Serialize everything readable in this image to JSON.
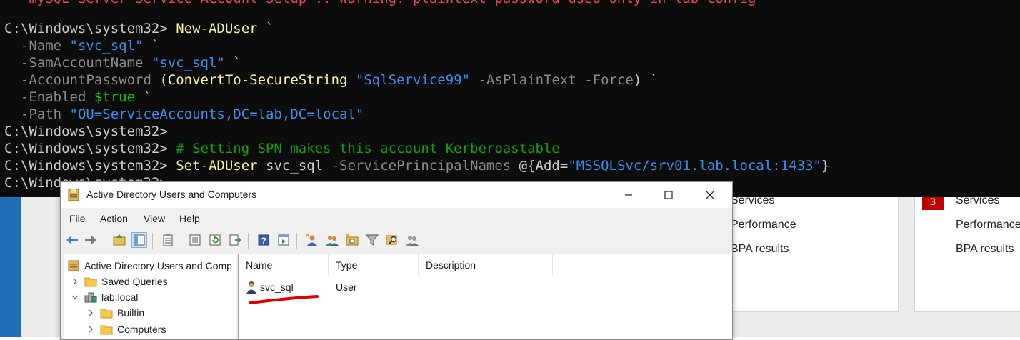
{
  "console": {
    "top_partial": "  -mySQL Server Service Account Setup :: Warning: plaintext password used only in lab config",
    "lines": [
      {
        "prompt": "C:\\Windows\\system32> ",
        "cmd": "New-ADUser",
        "rest": " `"
      },
      {
        "param": "  -Name ",
        "str": "\"svc_sql\"",
        "rest": " `"
      },
      {
        "param": "  -SamAccountName ",
        "str": "\"svc_sql\"",
        "rest": " `"
      },
      {
        "param": "  -AccountPassword ",
        "paren_open": "(",
        "cmd": "ConvertTo-SecureString",
        "space": " ",
        "str": "\"SqlService99\"",
        "param2": " -AsPlainText -Force",
        "paren_close": ")",
        "rest": " `"
      },
      {
        "param": "  -Enabled ",
        "var": "$true",
        "rest": " `"
      },
      {
        "param": "  -Path ",
        "str": "\"OU=ServiceAccounts,DC=lab,DC=local\""
      },
      {
        "prompt": "C:\\Windows\\system32>"
      },
      {
        "prompt": "C:\\Windows\\system32> ",
        "comment": "# Setting SPN makes this account Kerberoastable"
      },
      {
        "prompt": "C:\\Windows\\system32> ",
        "cmd": "Set-ADUser",
        "arg": " svc_sql",
        "param": " -ServicePrincipalNames",
        "brace_open": " @{Add=",
        "str": "\"MSSQLSvc/srv01.lab.local:1433\"",
        "brace_close": "}"
      },
      {
        "prompt": "C:\\Windows\\system32>"
      }
    ]
  },
  "server_manager": {
    "tile1": [
      "Services",
      "Performance",
      "BPA results"
    ],
    "tile2": {
      "badge": "3",
      "items": [
        "Services",
        "Performance",
        "BPA results"
      ]
    },
    "accent": "#1e6fb8",
    "badge_color": "#c00000"
  },
  "aduc": {
    "title": "Active Directory Users and Computers",
    "menu": [
      "File",
      "Action",
      "View",
      "Help"
    ],
    "tree": [
      {
        "label": "Active Directory Users and Comp",
        "icon": "aduc-root-icon"
      },
      {
        "label": "Saved Queries",
        "icon": "folder-icon"
      },
      {
        "label": "lab.local",
        "icon": "domain-icon"
      },
      {
        "label": "Builtin",
        "icon": "folder-icon"
      },
      {
        "label": "Computers",
        "icon": "folder-icon"
      }
    ],
    "columns": [
      "Name",
      "Type",
      "Description"
    ],
    "rows": [
      {
        "name": "svc_sql",
        "type": "User",
        "description": ""
      }
    ],
    "annotation_color": "#e00000"
  }
}
